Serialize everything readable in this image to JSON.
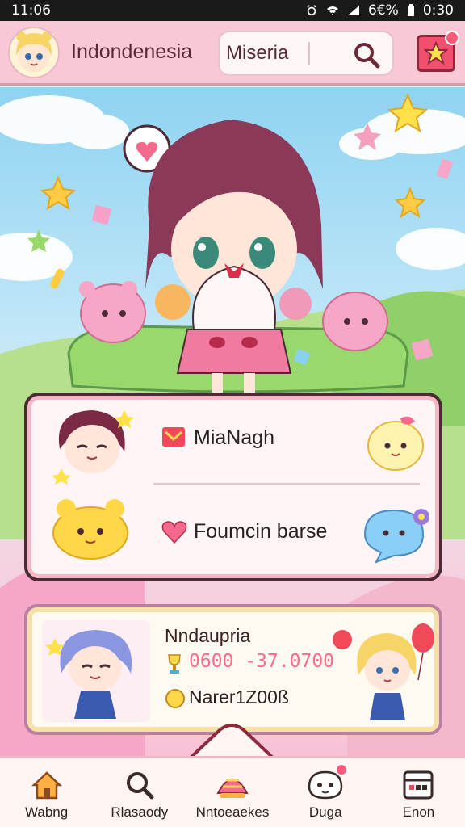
{
  "status_bar": {
    "time": "11:06",
    "battery_text": "6€%",
    "clock_right": "0:30"
  },
  "header": {
    "title": "Indondenesia",
    "search": {
      "value": "Miseria",
      "placeholder": "Miseria"
    }
  },
  "card_friends": {
    "rows": [
      {
        "label": "MiaNagh",
        "icon": "mail-icon"
      },
      {
        "label": "Foumcin barse",
        "icon": "heart-icon"
      }
    ]
  },
  "card_player": {
    "name": "Nndaupria",
    "score": "0600 -37.0700",
    "coins": "Narer1Z00ß"
  },
  "bottom_nav": {
    "items": [
      {
        "label": "Wabng",
        "icon": "home-icon"
      },
      {
        "label": "Rlasaody",
        "icon": "search-icon"
      },
      {
        "label": "Nntoeaekes",
        "icon": "shell-icon"
      },
      {
        "label": "Duga",
        "icon": "ghost-icon"
      },
      {
        "label": "Enon",
        "icon": "inventory-icon"
      }
    ]
  },
  "colors": {
    "header_bg": "#f8c8d4",
    "accent_pink": "#f0506e",
    "score_pink": "#ff6a88",
    "card_border": "#4a2a34",
    "nav_bg": "#fff5f3"
  }
}
